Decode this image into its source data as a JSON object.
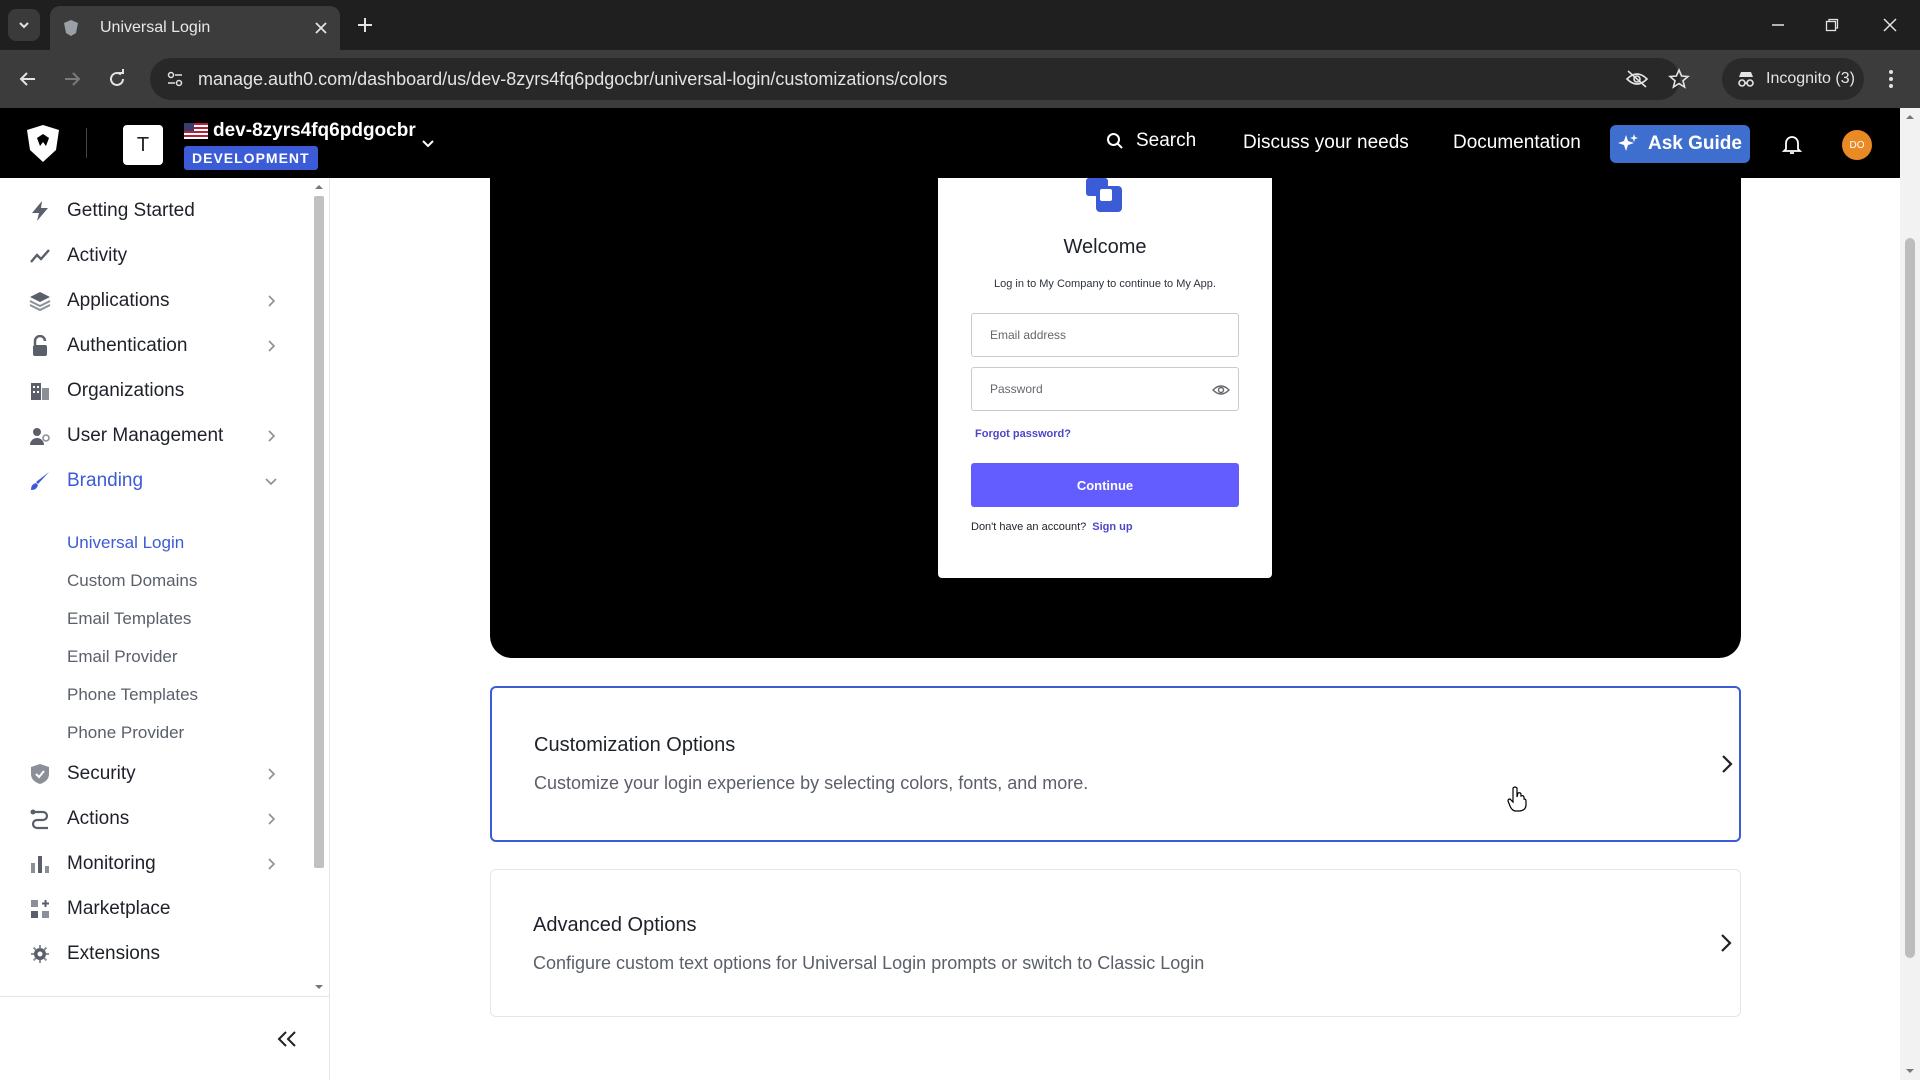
{
  "browser": {
    "tab_title": "Universal Login",
    "url": "manage.auth0.com/dashboard/us/dev-8zyrs4fq6pdgocbr/universal-login/customizations/colors",
    "incognito_label": "Incognito (3)"
  },
  "header": {
    "tenant_initial": "T",
    "tenant_name": "dev-8zyrs4fq6pdgocbr",
    "environment_badge": "DEVELOPMENT",
    "search_label": "Search",
    "discuss_label": "Discuss your needs",
    "docs_label": "Documentation",
    "ask_guide_label": "Ask Guide",
    "user_initials": "DO"
  },
  "sidebar": {
    "items": [
      {
        "label": "Getting Started",
        "icon": "bolt-icon"
      },
      {
        "label": "Activity",
        "icon": "activity-chart-icon"
      },
      {
        "label": "Applications",
        "icon": "layers-icon"
      },
      {
        "label": "Authentication",
        "icon": "lock-icon"
      },
      {
        "label": "Organizations",
        "icon": "building-icon"
      },
      {
        "label": "User Management",
        "icon": "users-icon"
      },
      {
        "label": "Branding",
        "icon": "brush-icon"
      },
      {
        "label": "Security",
        "icon": "shield-check-icon"
      },
      {
        "label": "Actions",
        "icon": "actions-flow-icon"
      },
      {
        "label": "Monitoring",
        "icon": "bar-chart-icon"
      },
      {
        "label": "Marketplace",
        "icon": "marketplace-plus-icon"
      },
      {
        "label": "Extensions",
        "icon": "gear-extension-icon"
      }
    ],
    "branding_sub": [
      "Universal Login",
      "Custom Domains",
      "Email Templates",
      "Email Provider",
      "Phone Templates",
      "Phone Provider"
    ],
    "active_sub": "Universal Login"
  },
  "preview": {
    "title": "Welcome",
    "subtitle": "Log in to My Company to continue to My App.",
    "email_placeholder": "Email address",
    "password_placeholder": "Password",
    "forgot_label": "Forgot password?",
    "continue_label": "Continue",
    "no_account_text": "Don't have an account?",
    "signup_label": "Sign up",
    "button_color": "#635dff"
  },
  "options": [
    {
      "title": "Customization Options",
      "description": "Customize your login experience by selecting colors, fonts, and more."
    },
    {
      "title": "Advanced Options",
      "description": "Configure custom text options for Universal Login prompts or switch to Classic Login"
    }
  ],
  "colors": {
    "accent": "#3c5bd6",
    "ask_guide": "#3f6fce",
    "avatar": "#e98a24"
  }
}
